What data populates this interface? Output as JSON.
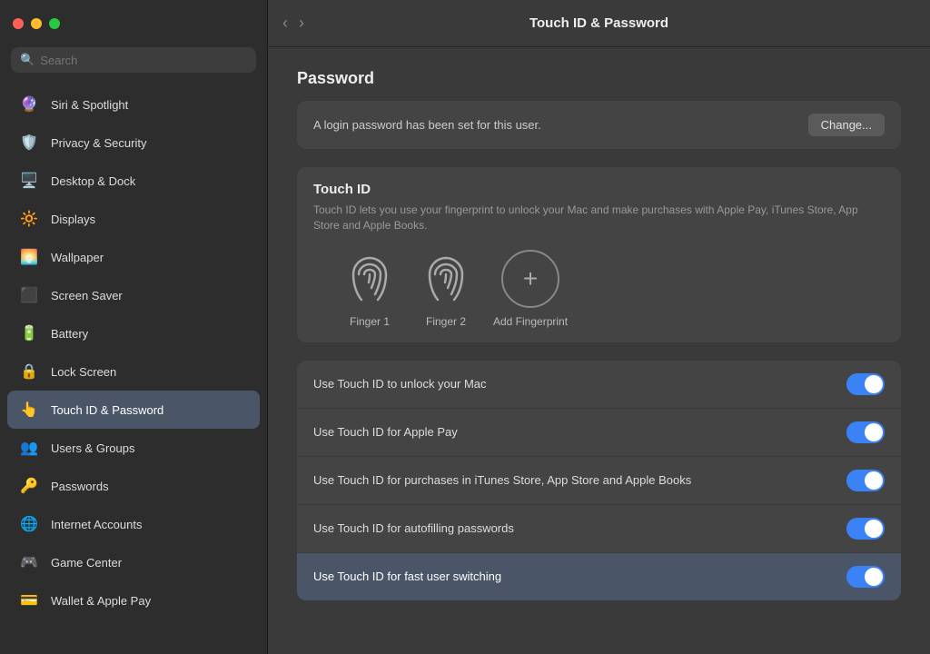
{
  "window": {
    "title": "Touch ID & Password",
    "buttons": {
      "close": "●",
      "minimize": "●",
      "maximize": "●"
    }
  },
  "sidebar": {
    "search_placeholder": "Search",
    "items": [
      {
        "id": "siri-spotlight",
        "label": "Siri & Spotlight",
        "icon": "🔮",
        "active": false
      },
      {
        "id": "privacy-security",
        "label": "Privacy & Security",
        "icon": "🛡️",
        "active": false
      },
      {
        "id": "desktop-dock",
        "label": "Desktop & Dock",
        "icon": "🖥️",
        "active": false
      },
      {
        "id": "displays",
        "label": "Displays",
        "icon": "🔆",
        "active": false
      },
      {
        "id": "wallpaper",
        "label": "Wallpaper",
        "icon": "🌅",
        "active": false
      },
      {
        "id": "screen-saver",
        "label": "Screen Saver",
        "icon": "⬛",
        "active": false
      },
      {
        "id": "battery",
        "label": "Battery",
        "icon": "🔋",
        "active": false
      },
      {
        "id": "lock-screen",
        "label": "Lock Screen",
        "icon": "🔒",
        "active": false
      },
      {
        "id": "touch-id-password",
        "label": "Touch ID & Password",
        "icon": "👆",
        "active": true
      },
      {
        "id": "users-groups",
        "label": "Users & Groups",
        "icon": "👥",
        "active": false
      },
      {
        "id": "passwords",
        "label": "Passwords",
        "icon": "🔑",
        "active": false
      },
      {
        "id": "internet-accounts",
        "label": "Internet Accounts",
        "icon": "🌐",
        "active": false
      },
      {
        "id": "game-center",
        "label": "Game Center",
        "icon": "🎮",
        "active": false
      },
      {
        "id": "wallet-apple-pay",
        "label": "Wallet & Apple Pay",
        "icon": "💳",
        "active": false
      }
    ]
  },
  "main": {
    "header_title": "Touch ID & Password",
    "password_section": {
      "label": "Password",
      "description": "A login password has been set for this user.",
      "change_button": "Change..."
    },
    "touch_id_section": {
      "title": "Touch ID",
      "description": "Touch ID lets you use your fingerprint to unlock your Mac and make purchases with Apple Pay, iTunes Store, App Store and Apple Books.",
      "fingers": [
        {
          "id": "finger1",
          "label": "Finger 1"
        },
        {
          "id": "finger2",
          "label": "Finger 2"
        }
      ],
      "add_label": "Add Fingerprint"
    },
    "toggles": [
      {
        "id": "unlock-mac",
        "label": "Use Touch ID to unlock your Mac",
        "state": "on",
        "highlighted": false
      },
      {
        "id": "apple-pay",
        "label": "Use Touch ID for Apple Pay",
        "state": "on",
        "highlighted": false
      },
      {
        "id": "itunes-store",
        "label": "Use Touch ID for purchases in iTunes Store, App Store and Apple Books",
        "state": "on",
        "highlighted": false
      },
      {
        "id": "autofill",
        "label": "Use Touch ID for autofilling passwords",
        "state": "on",
        "highlighted": false
      },
      {
        "id": "user-switching",
        "label": "Use Touch ID for fast user switching",
        "state": "on",
        "highlighted": true
      }
    ]
  },
  "colors": {
    "sidebar_bg": "#2d2d2d",
    "main_bg": "#3a3a3a",
    "active_item": "#4a5568",
    "toggle_on": "#3b82f6",
    "highlighted_row": "#4a5568"
  }
}
